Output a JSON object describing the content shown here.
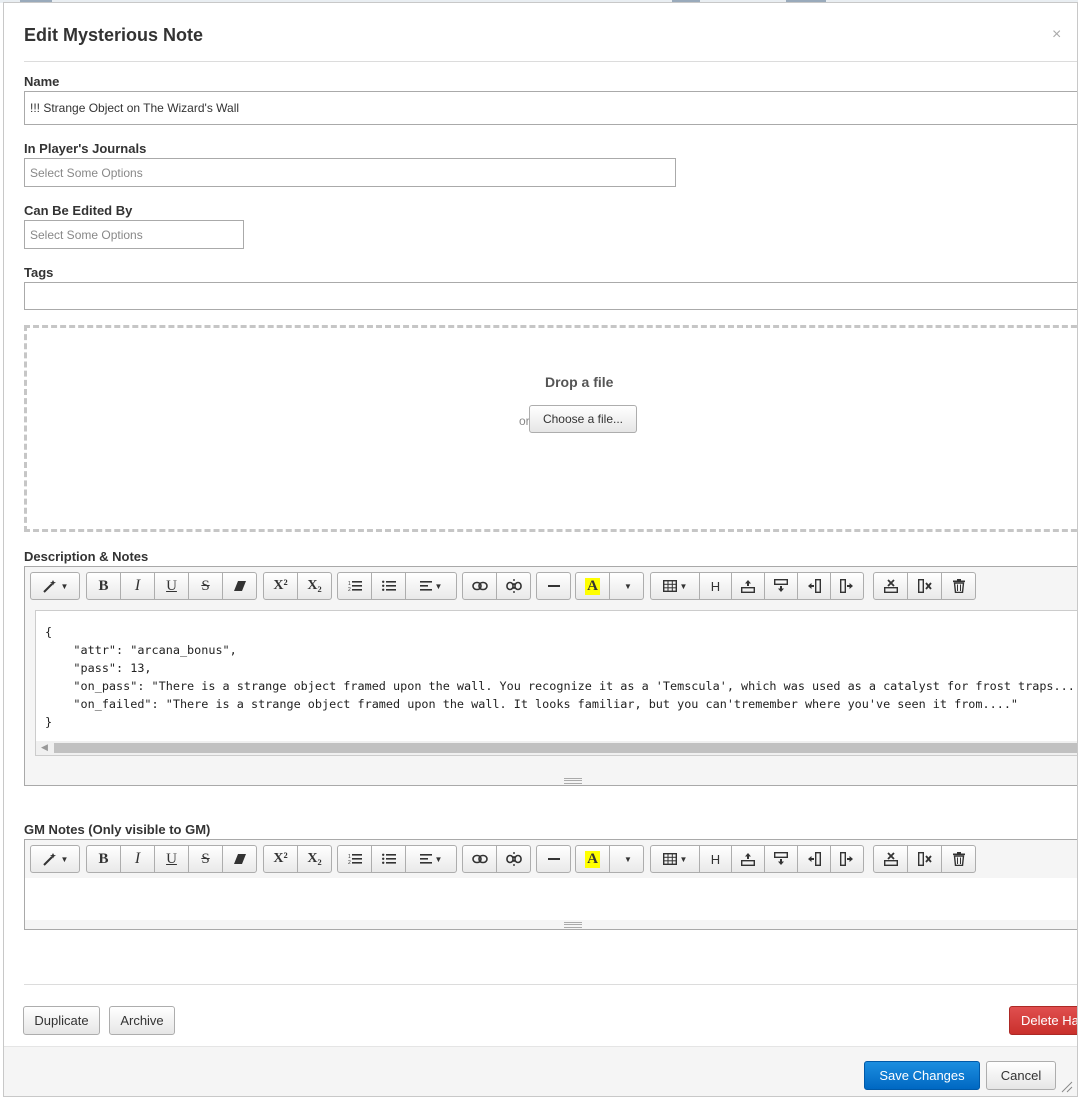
{
  "dialog": {
    "title": "Edit Mysterious Note",
    "close_symbol": "×"
  },
  "fields": {
    "name_label": "Name",
    "name_value": "!!! Strange Object on The Wizard's Wall",
    "journals_label": "In Player's Journals",
    "journals_placeholder": "Select Some Options",
    "edited_by_label": "Can Be Edited By",
    "edited_by_placeholder": "Select Some Options",
    "tags_label": "Tags",
    "tags_value": ""
  },
  "dropzone": {
    "title": "Drop a file",
    "or_text": "or",
    "choose_label": "Choose a file..."
  },
  "description": {
    "label": "Description & Notes",
    "code_lines": [
      "{",
      "    \"attr\": \"arcana_bonus\",",
      "    \"pass\": 13,",
      "    \"on_pass\": \"There is a strange object framed upon the wall. You recognize it as a 'Temscula', which was used as a catalyst for frost traps...",
      "    \"on_failed\": \"There is a strange object framed upon the wall. It looks familiar, but you can'tremember where you've seen it from....\"",
      "}"
    ]
  },
  "gm_notes": {
    "label": "GM Notes (Only visible to GM)"
  },
  "toolbar": {
    "bold": "B",
    "italic": "I",
    "underline": "U",
    "strike": "S",
    "superscript": "X²",
    "subscript": "X₂",
    "heading": "H",
    "highlight": "A"
  },
  "actions": {
    "duplicate_label": "Duplicate",
    "archive_label": "Archive",
    "delete_label": "Delete Ha",
    "save_label": "Save Changes",
    "cancel_label": "Cancel"
  },
  "colors": {
    "primary": "#0a73cf",
    "danger": "#d43f3a",
    "highlight": "#ffff00"
  }
}
